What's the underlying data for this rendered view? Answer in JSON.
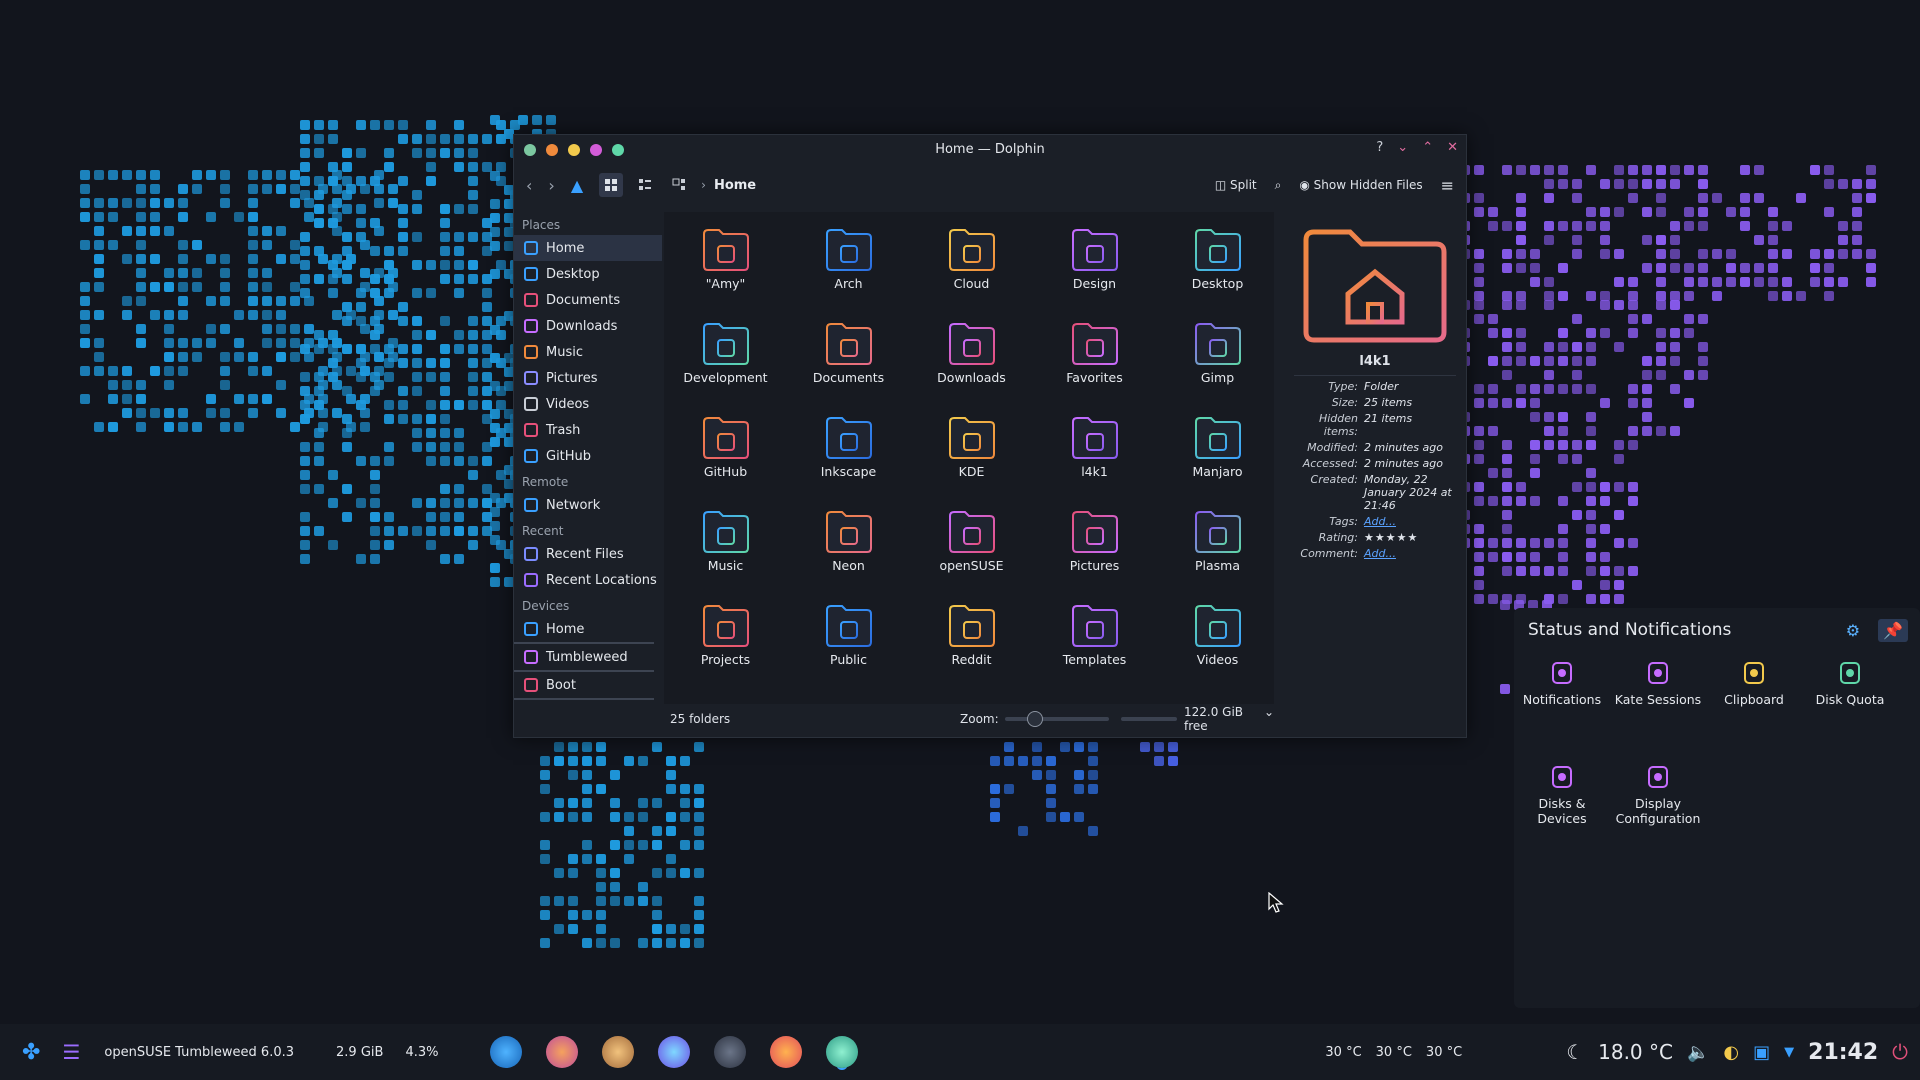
{
  "window": {
    "title": "Home — Dolphin",
    "controls": [
      "?",
      "⌄",
      "⌃",
      "✕"
    ]
  },
  "toolbar": {
    "breadcrumb": "Home",
    "split_label": "Split",
    "show_hidden_label": "Show Hidden Files"
  },
  "sidebar": {
    "places_header": "Places",
    "places": [
      "Home",
      "Desktop",
      "Documents",
      "Downloads",
      "Music",
      "Pictures",
      "Videos",
      "Trash",
      "GitHub"
    ],
    "remote_header": "Remote",
    "remote": [
      "Network"
    ],
    "recent_header": "Recent",
    "recent": [
      "Recent Files",
      "Recent Locations"
    ],
    "devices_header": "Devices",
    "devices": [
      "Home",
      "Tumbleweed",
      "Boot"
    ]
  },
  "folders": [
    "\"Amy\"",
    "Arch",
    "Cloud",
    "Design",
    "Desktop",
    "Development",
    "Documents",
    "Downloads",
    "Favorites",
    "Gimp",
    "GitHub",
    "Inkscape",
    "KDE",
    "l4k1",
    "Manjaro",
    "Music",
    "Neon",
    "openSUSE",
    "Pictures",
    "Plasma",
    "Projects",
    "Public",
    "Reddit",
    "Templates",
    "Videos"
  ],
  "statusbar": {
    "count": "25 folders",
    "zoom_label": "Zoom:",
    "free_space": "122.0 GiB free"
  },
  "info_panel": {
    "name": "l4k1",
    "rows": [
      {
        "key": "Type:",
        "value": "Folder"
      },
      {
        "key": "Size:",
        "value": "25 items"
      },
      {
        "key": "Hidden items:",
        "value": "21 items"
      },
      {
        "key": "Modified:",
        "value": "2 minutes ago"
      },
      {
        "key": "Accessed:",
        "value": "2 minutes ago"
      },
      {
        "key": "Created:",
        "value": "Monday, 22 January 2024 at 21:46"
      },
      {
        "key": "Tags:",
        "value": "Add..."
      },
      {
        "key": "Rating:",
        "value": "★★★★★"
      },
      {
        "key": "Comment:",
        "value": "Add..."
      }
    ]
  },
  "notifications_panel": {
    "title": "Status and Notifications",
    "items": [
      "Notifications",
      "Kate Sessions",
      "Clipboard",
      "Disk Quota",
      "Disks & Devices",
      "Display Configuration"
    ]
  },
  "taskbar": {
    "distro": "openSUSE Tumbleweed 6.0.3",
    "memory": "2.9 GiB",
    "cpu": "4.3%",
    "temps": [
      "30 °C",
      "30 °C",
      "30 °C"
    ],
    "weather": "18.0 °C",
    "clock": "21:42"
  },
  "colors": {
    "accent_blue": "#1e9be0",
    "accent_purple": "#8a5cf0",
    "window_bg": "#1b1f27"
  }
}
